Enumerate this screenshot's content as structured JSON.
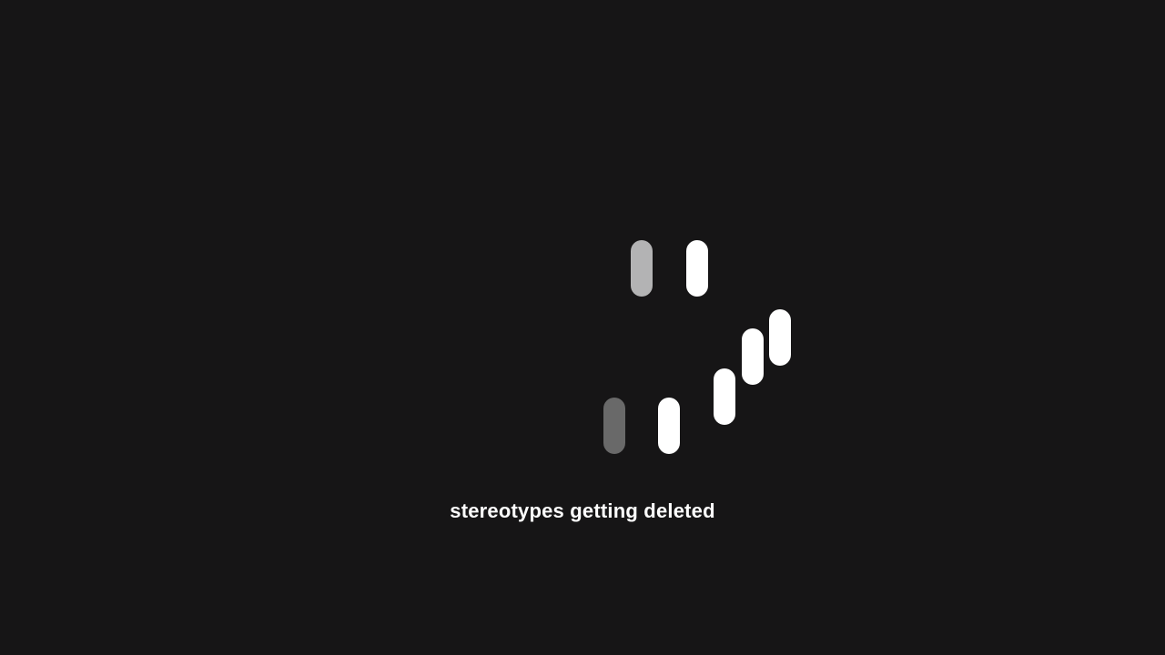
{
  "caption": {
    "text": "stereotypes getting deleted"
  },
  "loader": {
    "pills": [
      {
        "name": "loader-pill-1",
        "color": "#b3b3b4"
      },
      {
        "name": "loader-pill-2",
        "color": "#ffffff"
      },
      {
        "name": "loader-pill-3",
        "color": "#ffffff"
      },
      {
        "name": "loader-pill-4",
        "color": "#ffffff"
      },
      {
        "name": "loader-pill-5",
        "color": "#ffffff"
      },
      {
        "name": "loader-pill-6",
        "color": "#ffffff"
      },
      {
        "name": "loader-pill-7",
        "color": "#696969"
      }
    ]
  },
  "colors": {
    "background": "#161516",
    "text": "#ffffff"
  }
}
